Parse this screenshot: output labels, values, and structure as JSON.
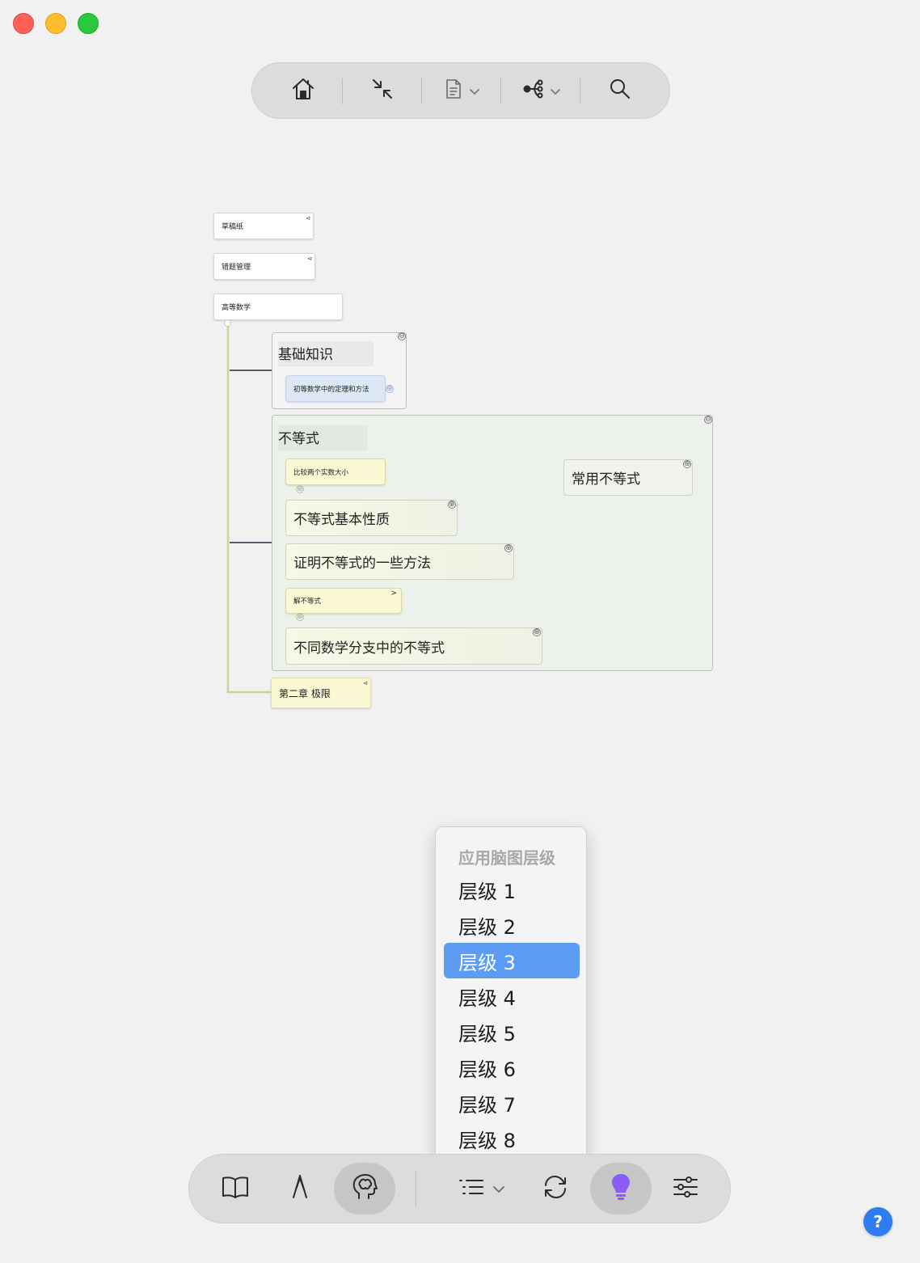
{
  "window": {
    "controls": [
      "close",
      "minimize",
      "zoom"
    ]
  },
  "top_toolbar": {
    "buttons": [
      {
        "icon": "home-icon"
      },
      {
        "icon": "collapse-arrows-icon"
      },
      {
        "icon": "document-icon",
        "has_dropdown": true
      },
      {
        "icon": "mindmap-share-icon",
        "has_dropdown": true
      },
      {
        "icon": "search-icon"
      }
    ]
  },
  "mindmap": {
    "notebooks": [
      {
        "label": "草稿纸",
        "icon": "mindmap-link-icon"
      },
      {
        "label": "错题管理",
        "icon": "mindmap-link-icon"
      },
      {
        "label": "高等数学"
      }
    ],
    "groups": [
      {
        "title": "基础知识",
        "toggle": "⊖",
        "cards": [
          {
            "label": "初等数学中的定理和方法",
            "toggle": "⊕"
          }
        ]
      },
      {
        "title": "不等式",
        "toggle": "⊖",
        "cards": [
          {
            "label": "比较两个实数大小",
            "toggle": "⊕"
          },
          {
            "label": "常用不等式",
            "toggle": "⊕"
          },
          {
            "label": "不等式基本性质",
            "toggle": "⊕"
          },
          {
            "label": "证明不等式的一些方法",
            "toggle": "⊕"
          },
          {
            "label": "解不等式",
            "marker": ">",
            "toggle": "⊕"
          },
          {
            "label": "不同数学分支中的不等式",
            "toggle": "⊕"
          }
        ]
      }
    ],
    "chapter_node": {
      "label": "第二章 极限",
      "icon": "mindmap-link-icon"
    }
  },
  "level_menu": {
    "header": "应用脑图层级",
    "items": [
      "层级 1",
      "层级 2",
      "层级 3",
      "层级 4",
      "层级 5",
      "层级 6",
      "层级 7",
      "层级 8"
    ],
    "selected": "层级 3"
  },
  "bottom_toolbar": {
    "buttons": [
      {
        "icon": "book-icon"
      },
      {
        "icon": "pen-nib-icon"
      },
      {
        "icon": "brain-icon",
        "active": true
      },
      {
        "icon": "list-icon",
        "has_dropdown": true
      },
      {
        "icon": "sync-icon"
      },
      {
        "icon": "lightbulb-icon",
        "active": true,
        "color": "#8b5cf6"
      },
      {
        "icon": "sliders-icon"
      }
    ]
  },
  "help_button": {
    "label": "?",
    "color": "#2d7cf0"
  }
}
